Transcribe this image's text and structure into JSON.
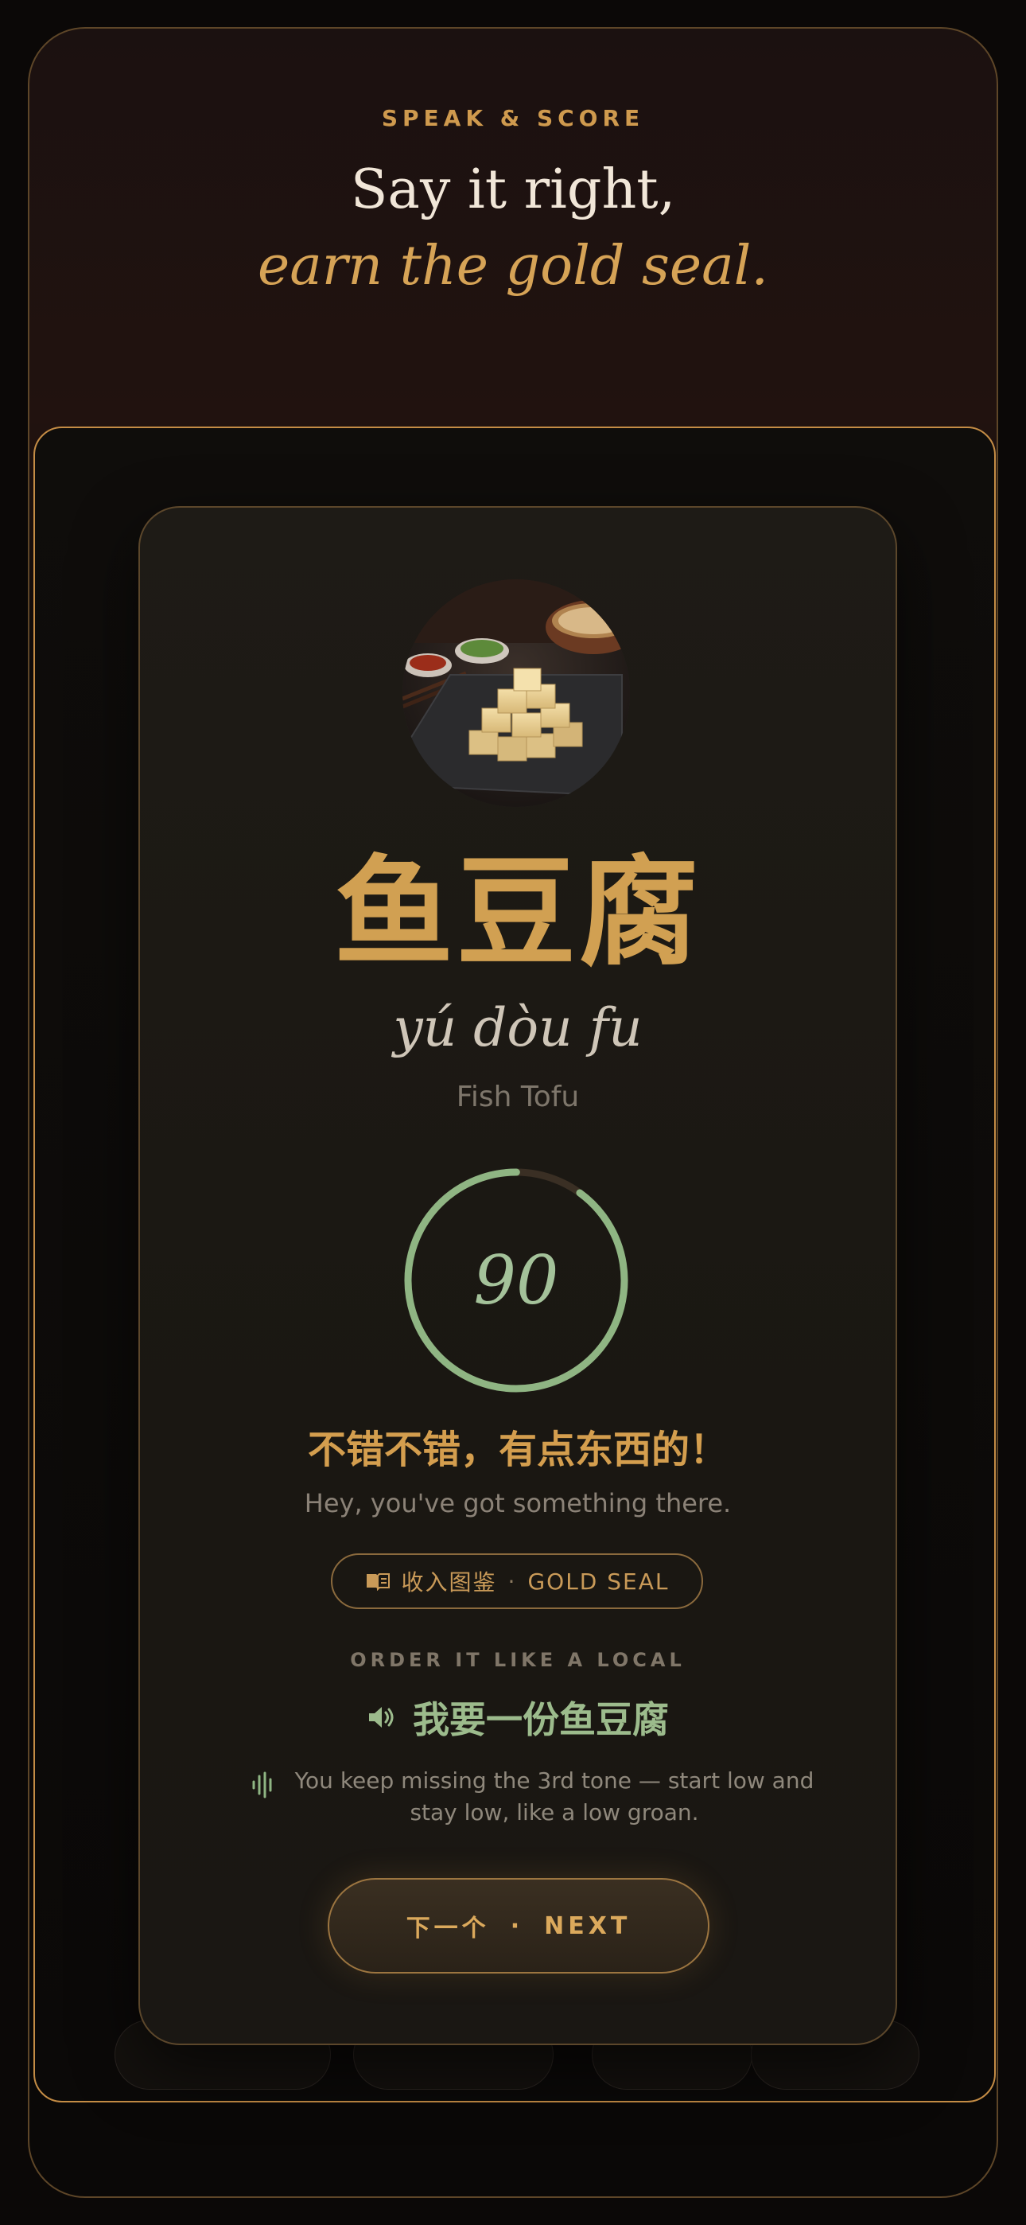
{
  "header": {
    "eyebrow": "SPEAK & SCORE",
    "headline": "Say it right,",
    "headline_accent": "earn the gold seal."
  },
  "dish": {
    "hanzi": "鱼豆腐",
    "pinyin": "yú dòu fu",
    "meaning": "Fish Tofu",
    "photo_icon": "fish-tofu-photo"
  },
  "score": {
    "value": "90",
    "fraction": 0.9,
    "ring_color": "#8fb583"
  },
  "feedback": {
    "verdict_cn": "不错不错，有点东西的！",
    "verdict_en": "Hey, you've got something there."
  },
  "seal_badge": {
    "icon": "book-icon",
    "label_cn": "收入图鉴",
    "separator": "·",
    "label_en": "GOLD SEAL"
  },
  "order": {
    "label": "ORDER IT LIKE A LOCAL",
    "icon": "speaker-icon",
    "phrase": "我要一份鱼豆腐"
  },
  "tip": {
    "icon": "waveform-icon",
    "text": "You keep missing the 3rd tone — start low and stay low, like a low groan."
  },
  "next_button": {
    "label_cn": "下一个",
    "separator": "·",
    "label_en": "NEXT"
  },
  "colors": {
    "gold": "#d1a052",
    "green": "#9cbb8c",
    "background": "#0b0807"
  }
}
